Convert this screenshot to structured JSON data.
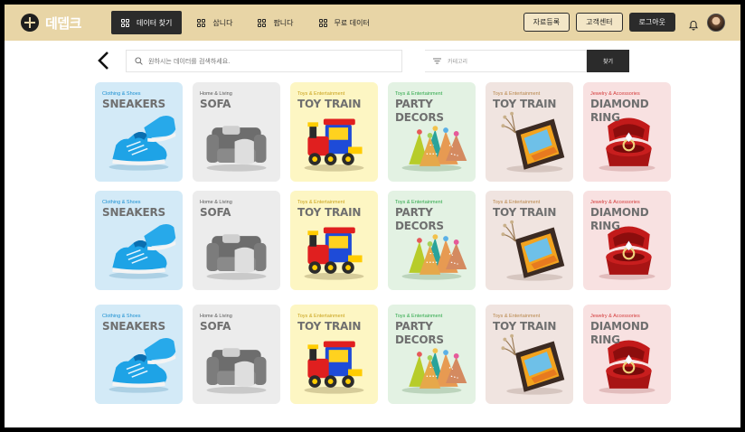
{
  "header": {
    "logo_text": "데뎁크",
    "nav": [
      {
        "label": "데이터 찾기",
        "active": true
      },
      {
        "label": "삽니다",
        "active": false
      },
      {
        "label": "팝니다",
        "active": false
      },
      {
        "label": "무료 데이터",
        "active": false
      }
    ],
    "register_label": "자료등록",
    "support_label": "고객센터",
    "logout_label": "로그아웃"
  },
  "search": {
    "placeholder": "원하시는 데이터를 검색하세요.",
    "category_placeholder": "카테고리",
    "button_label": "찾기"
  },
  "colors": {
    "header_bg": "#e8d5a6",
    "blue_card": "#d3eaf7",
    "grey_card": "#ececec",
    "yellow_card": "#fdf6c3",
    "green_card": "#e3f2e3",
    "beige_card": "#f0e4e0",
    "pink_card": "#f8e1e1"
  },
  "product_rows": [
    [
      {
        "category": "Clothing & Shoes",
        "title": "SNEAKERS",
        "icon": "sneaker-icon"
      },
      {
        "category": "Home & Living",
        "title": "SOFA",
        "icon": "armchair-icon"
      },
      {
        "category": "Toys & Entertainment",
        "title": "TOY TRAIN",
        "icon": "toy-train-icon"
      },
      {
        "category": "Toys & Entertainment",
        "title": "PARTY DECORS",
        "icon": "party-hats-icon"
      },
      {
        "category": "Toys & Entertainment",
        "title": "TOY TRAIN",
        "icon": "picture-frame-icon"
      },
      {
        "category": "Jewelry & Accessories",
        "title": "DIAMOND RING",
        "icon": "ring-box-icon"
      }
    ],
    [
      {
        "category": "Clothing & Shoes",
        "title": "SNEAKERS",
        "icon": "sneaker-icon"
      },
      {
        "category": "Home & Living",
        "title": "SOFA",
        "icon": "armchair-icon"
      },
      {
        "category": "Toys & Entertainment",
        "title": "TOY TRAIN",
        "icon": "toy-train-icon"
      },
      {
        "category": "Toys & Entertainment",
        "title": "PARTY DECORS",
        "icon": "party-hats-icon"
      },
      {
        "category": "Toys & Entertainment",
        "title": "TOY TRAIN",
        "icon": "picture-frame-icon"
      },
      {
        "category": "Jewelry & Accessories",
        "title": "DIAMOND RING",
        "icon": "ring-box-icon"
      }
    ],
    [
      {
        "category": "Clothing & Shoes",
        "title": "SNEAKERS",
        "icon": "sneaker-icon"
      },
      {
        "category": "Home & Living",
        "title": "SOFA",
        "icon": "armchair-icon"
      },
      {
        "category": "Toys & Entertainment",
        "title": "TOY TRAIN",
        "icon": "toy-train-icon"
      },
      {
        "category": "Toys & Entertainment",
        "title": "PARTY DECORS",
        "icon": "party-hats-icon"
      },
      {
        "category": "Toys & Entertainment",
        "title": "TOY TRAIN",
        "icon": "picture-frame-icon"
      },
      {
        "category": "Jewelry & Accessories",
        "title": "DIAMOND RING",
        "icon": "ring-box-icon"
      }
    ]
  ]
}
